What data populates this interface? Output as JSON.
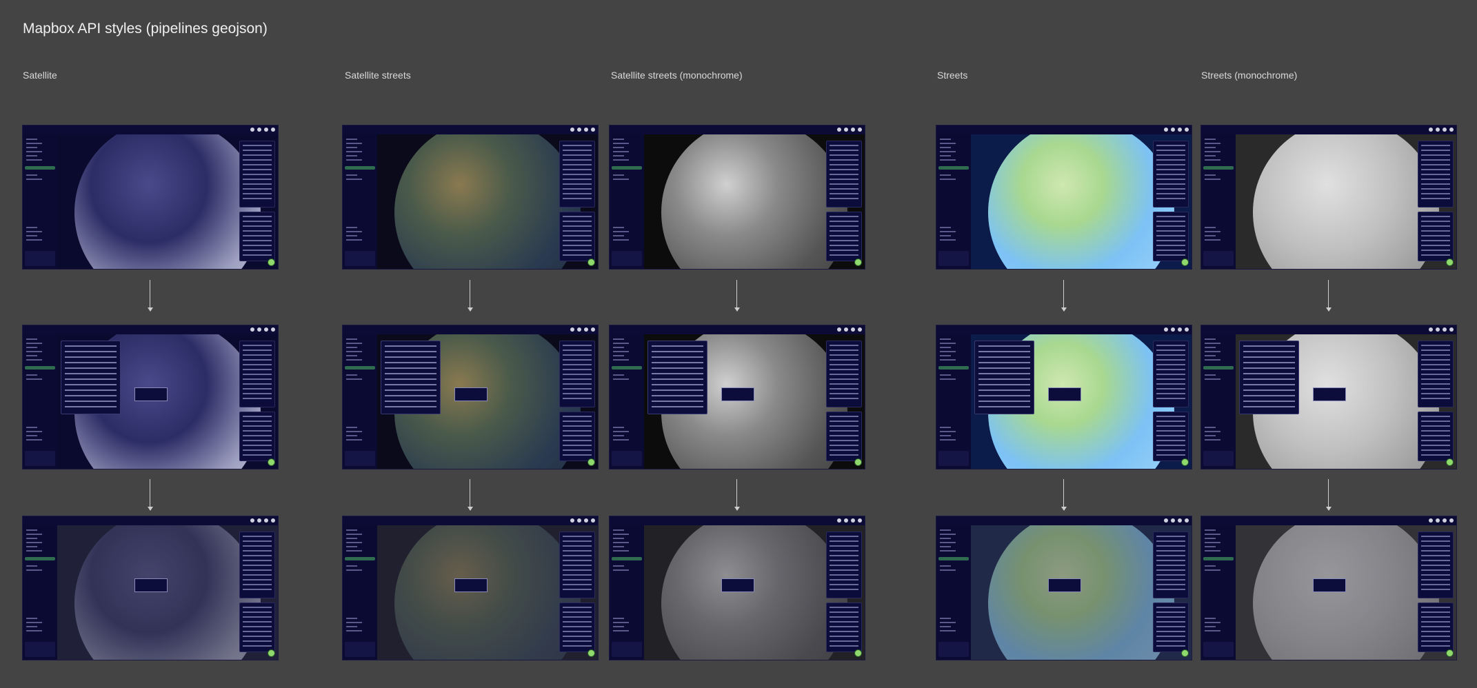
{
  "page": {
    "title": "Mapbox API styles (pipelines geojson)"
  },
  "columns": [
    {
      "label": "Satellite",
      "style": "satellite"
    },
    {
      "label": "Satellite streets",
      "style": "satellite-streets"
    },
    {
      "label": "Satellite streets  (monochrome)",
      "style": "satellite-mono"
    },
    {
      "label": "Streets",
      "style": "streets"
    },
    {
      "label": "Streets (monochrome)",
      "style": "streets-mono"
    }
  ],
  "rows": [
    {
      "state": "default"
    },
    {
      "state": "detail-panel-open"
    },
    {
      "state": "dimmed-tooltip"
    }
  ],
  "colors": {
    "background": "#444444",
    "app_navy": "#0a0a2e",
    "accent_green": "#8fd96d",
    "satellite_globe": "#b8b8cc",
    "satellite_streets_globe": "#3a4a5a",
    "mono_globe": "#6a6a6a",
    "streets_globe": "#7cc2f5",
    "streets_mono_globe": "#c8c8c8"
  }
}
